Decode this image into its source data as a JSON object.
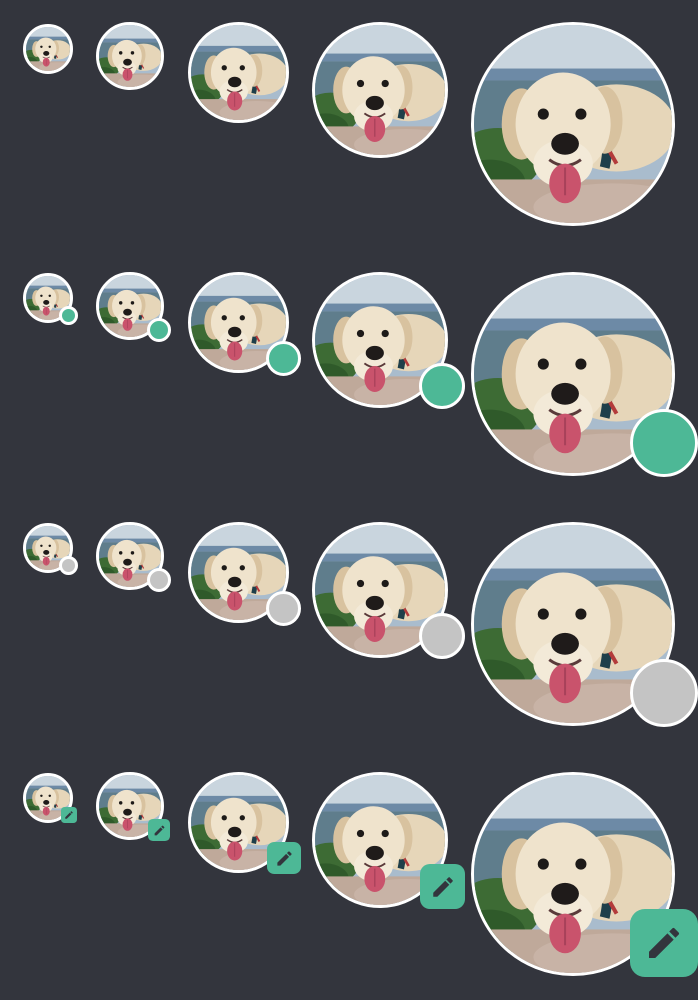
{
  "colors": {
    "background": "#33353d",
    "ring": "#ffffff",
    "online": "#4db896",
    "offline": "#c4c4c4",
    "edit": "#4db896"
  },
  "rows": [
    {
      "variant": "plain"
    },
    {
      "variant": "status-online"
    },
    {
      "variant": "status-offline"
    },
    {
      "variant": "editable"
    }
  ],
  "sizes": [
    "xs",
    "sm",
    "md",
    "lg",
    "xl"
  ],
  "icons": {
    "edit": "pencil-icon",
    "avatar": "dog-photo"
  }
}
